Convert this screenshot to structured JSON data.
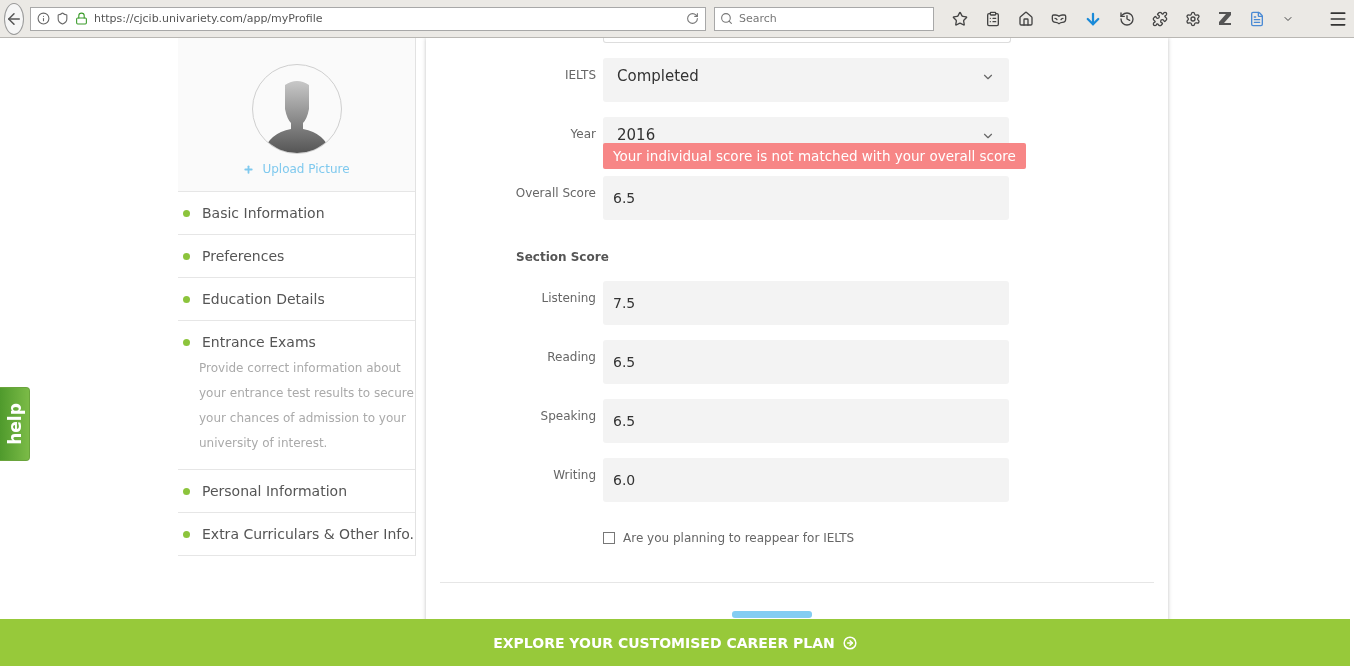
{
  "browser": {
    "url": "https://cjcib.univariety.com/app/myProfile",
    "search_placeholder": "Search"
  },
  "sidebar": {
    "upload_label": "Upload Picture",
    "items": [
      {
        "label": "Basic Information"
      },
      {
        "label": "Preferences"
      },
      {
        "label": "Education Details"
      },
      {
        "label": "Entrance Exams",
        "description": "Provide correct information about your entrance test results to secure your chances of admission to your university of interest."
      },
      {
        "label": "Personal Information"
      },
      {
        "label": "Extra Curriculars & Other Info."
      }
    ]
  },
  "form": {
    "fields": [
      {
        "kind": "select",
        "label": "IELTS",
        "value": "Completed"
      },
      {
        "kind": "select",
        "label": "Year",
        "value": "2016"
      },
      {
        "kind": "input",
        "label": "Overall Score",
        "value": "6.5",
        "error": "Your individual score is not matched with your overall score"
      }
    ],
    "section_heading": "Section Score",
    "sections": [
      {
        "kind": "input",
        "label": "Listening",
        "value": "7.5"
      },
      {
        "kind": "input",
        "label": "Reading",
        "value": "6.5"
      },
      {
        "kind": "input",
        "label": "Speaking",
        "value": "6.5"
      },
      {
        "kind": "input",
        "label": "Writing",
        "value": "6.0"
      }
    ],
    "reappear": {
      "label": "Are you planning to reappear for IELTS",
      "checked": false
    }
  },
  "help_tab": "help",
  "footer": {
    "label": "EXPLORE YOUR CUSTOMISED CAREER PLAN"
  }
}
